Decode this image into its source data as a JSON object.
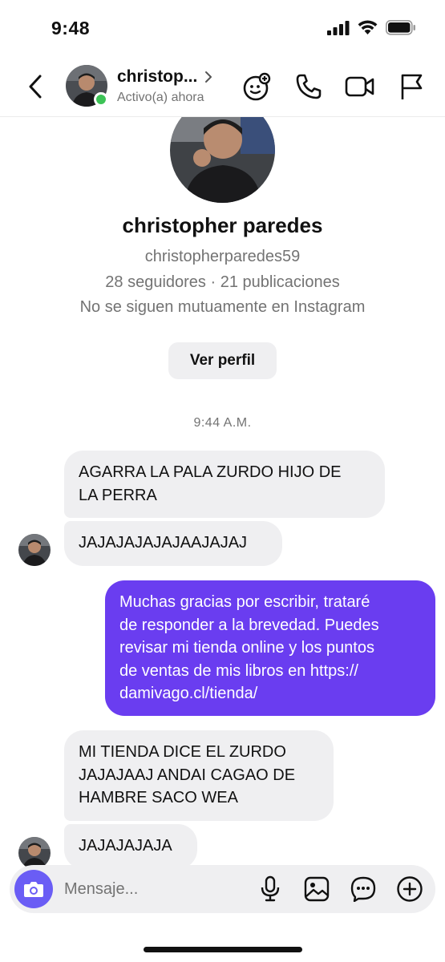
{
  "status_bar": {
    "time": "9:48"
  },
  "header": {
    "contact_name": "christop...",
    "contact_status": "Activo(a) ahora"
  },
  "profile": {
    "full_name": "christopher paredes",
    "username": "christopherparedes59",
    "stats": "28 seguidores · 21 publicaciones",
    "mutual": "No se siguen mutuamente en Instagram",
    "view_profile_label": "Ver perfil"
  },
  "thread": {
    "timestamp": "9:44 A.M.",
    "messages": [
      {
        "direction": "in",
        "lines": [
          "AGARRA LA PALA ZURDO HIJO DE",
          "LA PERRA"
        ]
      },
      {
        "direction": "in",
        "lines": [
          "JAJAJAJAJAJAAJAJAJ"
        ]
      },
      {
        "direction": "out",
        "lines": [
          "Muchas gracias por escribir, trataré",
          "de responder a la brevedad. Puedes",
          "revisar mi tienda online y los puntos",
          "de ventas de mis libros en  https://",
          "damivago.cl/tienda/"
        ]
      },
      {
        "direction": "in",
        "lines": [
          "MI TIENDA DICE EL ZURDO",
          "JAJAJAAJ ANDAI CAGAO DE",
          "HAMBRE SACO WEA"
        ]
      },
      {
        "direction": "in",
        "lines": [
          "JAJAJAJAJA"
        ]
      }
    ]
  },
  "composer": {
    "placeholder": "Mensaje..."
  },
  "colors": {
    "accent": "#6a3df0",
    "online": "#3cc356",
    "bubble_in": "#efeff1"
  }
}
